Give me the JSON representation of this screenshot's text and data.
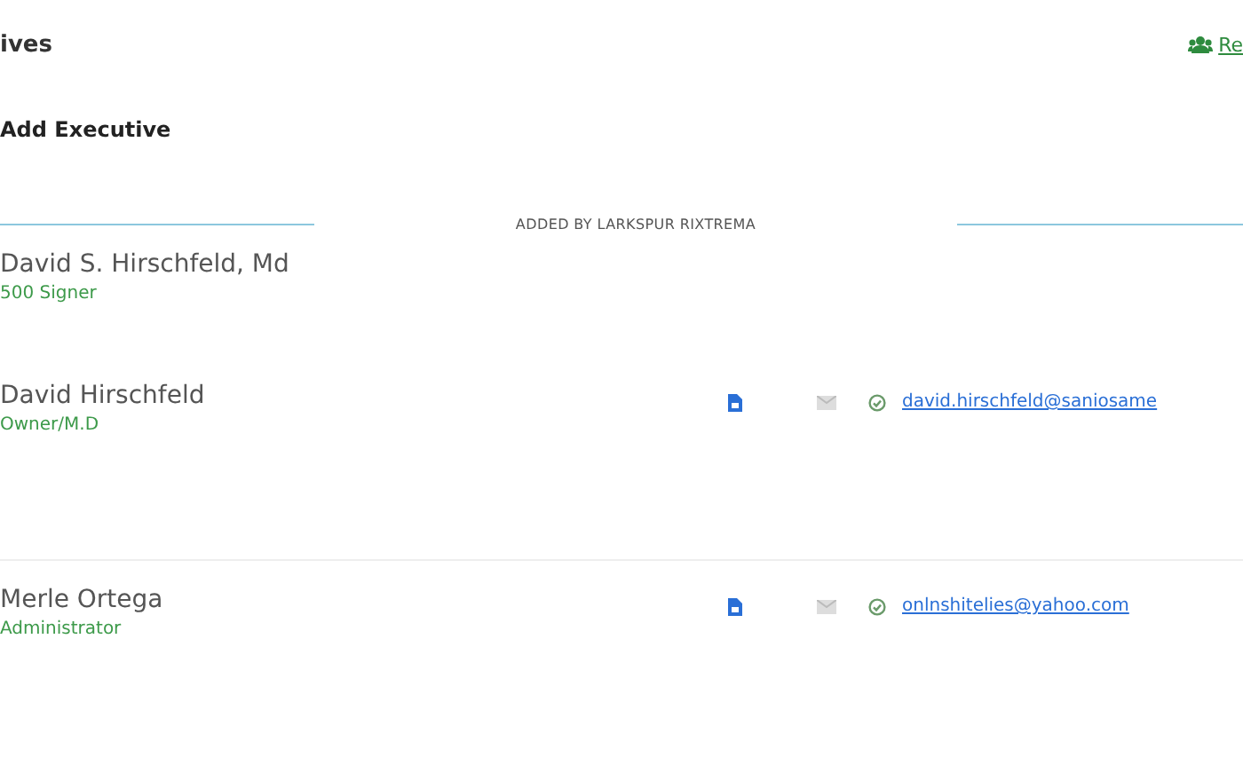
{
  "header": {
    "title": "ives",
    "link": "Re"
  },
  "add_button": "Add Executive",
  "section_label": "ADDED BY LARKSPUR RIXTREMA",
  "executives": [
    {
      "name": "David S. Hirschfeld, Md",
      "role": "500 Signer"
    },
    {
      "name": "David Hirschfeld",
      "role": "Owner/M.D",
      "email": "david.hirschfeld@saniosame",
      "verified": true
    },
    {
      "name": "Merle Ortega",
      "role": "Administrator",
      "email": "onlnshitelies@yahoo.com",
      "verified": true
    }
  ]
}
